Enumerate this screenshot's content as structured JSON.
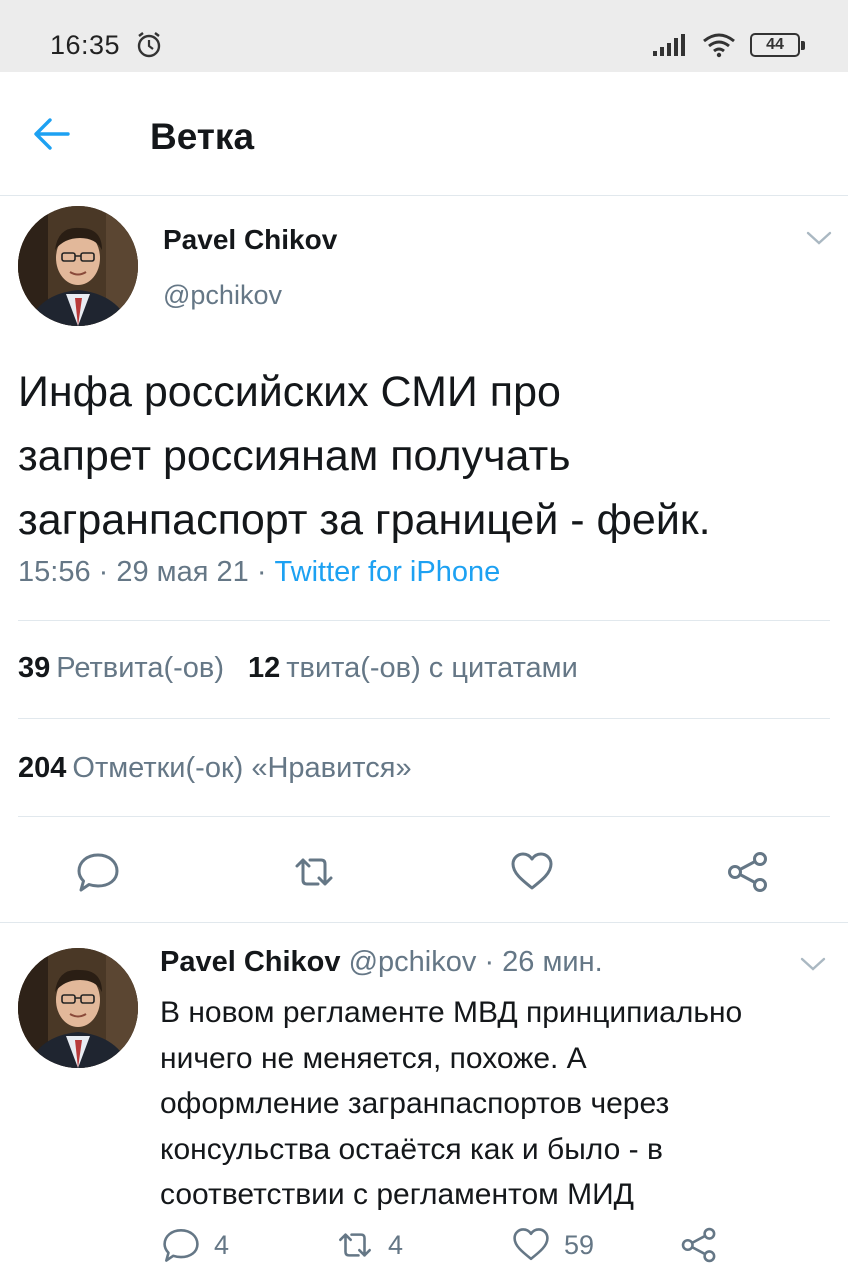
{
  "status_bar": {
    "time": "16:35",
    "battery": "44",
    "icons": [
      "alarm-icon",
      "signal-icon",
      "wifi-icon",
      "battery-icon"
    ]
  },
  "header": {
    "title": "Ветка",
    "back_icon": "arrow-left-icon"
  },
  "tweet": {
    "author_name": "Pavel Chikov",
    "author_handle": "@pchikov",
    "text": "Инфа российских СМИ про\nзапрет россиянам получать\nзагранпаспорт за границей - фейк.",
    "time": "15:56",
    "date": "29 мая 21",
    "source": "Twitter for iPhone",
    "retweets_count": "39",
    "retweets_label": "Ретвита(-ов)",
    "quotes_count": "12",
    "quotes_label": "твита(-ов) с цитатами",
    "likes_count": "204",
    "likes_label": "Отметки(-ок) «Нравится»"
  },
  "reply": {
    "author_name": "Pavel Chikov",
    "author_handle": "@pchikov",
    "time_ago": "26 мин.",
    "text": "В новом регламенте МВД принципиально\nничего не меняется, похоже. А\nоформление загранпаспортов через\nконсульства остаётся как и было - в\nсоответствии с регламентом МИД",
    "reply_count": "4",
    "retweet_count": "4",
    "like_count": "59"
  },
  "colors": {
    "accent": "#1da1f2",
    "muted": "#657786",
    "text": "#14171a",
    "divider": "#e1e8ed"
  }
}
